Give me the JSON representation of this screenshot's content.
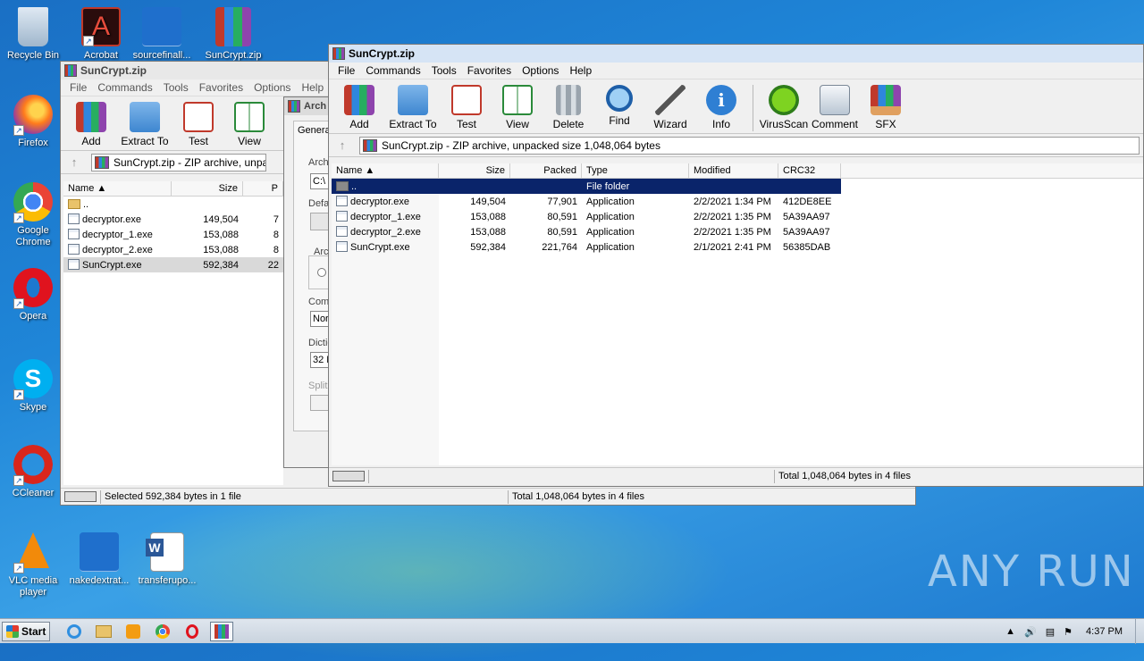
{
  "desktop": {
    "icons": [
      {
        "label": "Recycle Bin"
      },
      {
        "label": "Acrobat"
      },
      {
        "label": "sourcefinall..."
      },
      {
        "label": "SunCrypt.zip"
      },
      {
        "label": "Firefox"
      },
      {
        "label": "Google Chrome"
      },
      {
        "label": "Opera"
      },
      {
        "label": "Skype"
      },
      {
        "label": "CCleaner"
      },
      {
        "label": "VLC media player"
      },
      {
        "label": "nakedextrat..."
      },
      {
        "label": "transferupo..."
      }
    ],
    "watermark": "ANY RUN"
  },
  "back_window": {
    "title": "SunCrypt.zip",
    "menu": [
      "File",
      "Commands",
      "Tools",
      "Favorites",
      "Options",
      "Help"
    ],
    "toolbar": [
      "Add",
      "Extract To",
      "Test",
      "View"
    ],
    "address": "SunCrypt.zip - ZIP archive, unpacke",
    "columns": [
      "Name",
      "Size",
      "P"
    ],
    "rows": [
      {
        "name": "..",
        "size": "",
        "packed": ""
      },
      {
        "name": "decryptor.exe",
        "size": "149,504",
        "packed": "7"
      },
      {
        "name": "decryptor_1.exe",
        "size": "153,088",
        "packed": "8"
      },
      {
        "name": "decryptor_2.exe",
        "size": "153,088",
        "packed": "8"
      },
      {
        "name": "SunCrypt.exe",
        "size": "592,384",
        "packed": "22"
      }
    ],
    "status_left": "Selected 592,384 bytes in 1 file",
    "status_right": "Total 1,048,064 bytes in 4 files"
  },
  "dialog": {
    "title": "Arch",
    "tab": "Genera",
    "labels": [
      "Arch",
      "C:\\",
      "Defa",
      "Arc",
      "Com",
      "Nor",
      "Dictio",
      "32 K",
      "Split"
    ]
  },
  "front_window": {
    "title": "SunCrypt.zip",
    "menu": [
      "File",
      "Commands",
      "Tools",
      "Favorites",
      "Options",
      "Help"
    ],
    "toolbar": [
      "Add",
      "Extract To",
      "Test",
      "View",
      "Delete",
      "Find",
      "Wizard",
      "Info",
      "VirusScan",
      "Comment",
      "SFX"
    ],
    "address": "SunCrypt.zip - ZIP archive, unpacked size 1,048,064 bytes",
    "columns": [
      "Name",
      "Size",
      "Packed",
      "Type",
      "Modified",
      "CRC32"
    ],
    "rows": [
      {
        "name": "..",
        "size": "",
        "packed": "",
        "type": "File folder",
        "modified": "",
        "crc": ""
      },
      {
        "name": "decryptor.exe",
        "size": "149,504",
        "packed": "77,901",
        "type": "Application",
        "modified": "2/2/2021 1:34 PM",
        "crc": "412DE8EE"
      },
      {
        "name": "decryptor_1.exe",
        "size": "153,088",
        "packed": "80,591",
        "type": "Application",
        "modified": "2/2/2021 1:35 PM",
        "crc": "5A39AA97"
      },
      {
        "name": "decryptor_2.exe",
        "size": "153,088",
        "packed": "80,591",
        "type": "Application",
        "modified": "2/2/2021 1:35 PM",
        "crc": "5A39AA97"
      },
      {
        "name": "SunCrypt.exe",
        "size": "592,384",
        "packed": "221,764",
        "type": "Application",
        "modified": "2/1/2021 2:41 PM",
        "crc": "56385DAB"
      }
    ],
    "status_right": "Total 1,048,064 bytes in 4 files"
  },
  "taskbar": {
    "start_label": "Start",
    "clock": "4:37 PM"
  }
}
